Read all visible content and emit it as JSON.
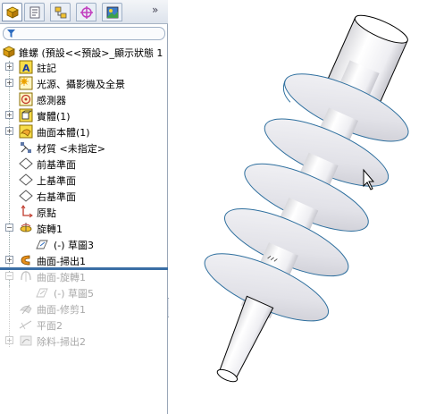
{
  "panel_tabs": [
    "feature-manager",
    "property-manager",
    "configuration-manager",
    "dimxpert-manager",
    "display-manager"
  ],
  "tab_more": "»",
  "tree": {
    "root": "錐螺 (預設<<預設>_顯示狀態 1",
    "items": [
      {
        "label": "註記",
        "icon": "annotation-icon"
      },
      {
        "label": "光源、攝影機及全景",
        "icon": "lights-cameras-icon"
      },
      {
        "label": "感測器",
        "icon": "sensor-icon"
      },
      {
        "label": "實體(1)",
        "icon": "solid-bodies-icon"
      },
      {
        "label": "曲面本體(1)",
        "icon": "surface-bodies-icon"
      },
      {
        "label": "材質 <未指定>",
        "icon": "material-icon"
      },
      {
        "label": "前基準面",
        "icon": "plane-icon"
      },
      {
        "label": "上基準面",
        "icon": "plane-icon"
      },
      {
        "label": "右基準面",
        "icon": "plane-icon"
      },
      {
        "label": "原點",
        "icon": "origin-icon"
      },
      {
        "label": "旋轉1",
        "icon": "revolve-icon"
      },
      {
        "label": "(-) 草圖3",
        "icon": "sketch-icon"
      },
      {
        "label": "曲面-掃出1",
        "icon": "surface-sweep-icon"
      },
      {
        "label": "曲面-旋轉1",
        "icon": "surface-revolve-icon"
      },
      {
        "label": "(-) 草圖5",
        "icon": "sketch-icon"
      },
      {
        "label": "曲面-修剪1",
        "icon": "surface-trim-icon"
      },
      {
        "label": "平面2",
        "icon": "plane-icon"
      },
      {
        "label": "除料-掃出2",
        "icon": "cut-sweep-icon"
      }
    ]
  },
  "colors": {
    "accent": "#3a6ea5",
    "edge": "#2e6f9e",
    "dim_text": "#a8a8a8"
  }
}
